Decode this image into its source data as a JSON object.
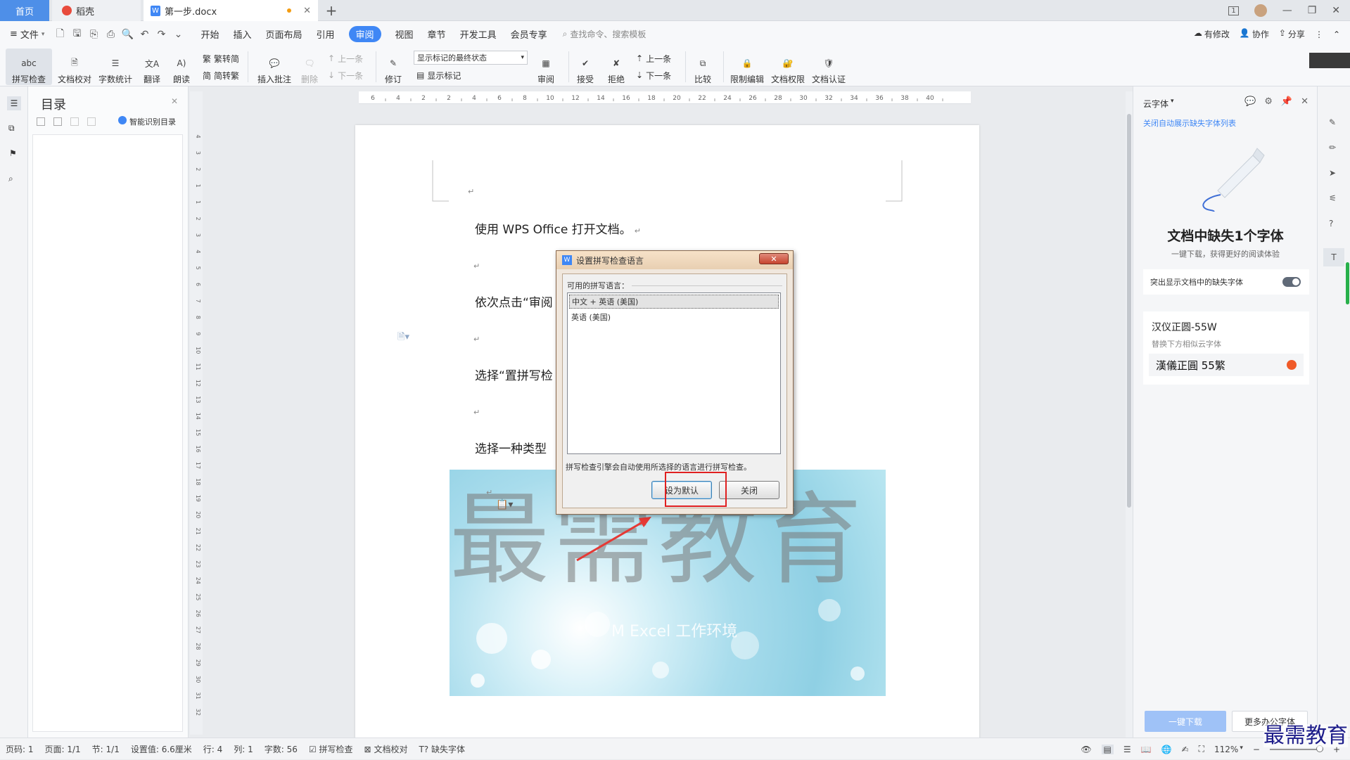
{
  "tabs": {
    "home": "首页",
    "draft": "稻壳",
    "doc": "第一步.docx",
    "add": "+"
  },
  "window": {
    "page_badge": "1"
  },
  "menu": {
    "file": "文件",
    "items": [
      "开始",
      "插入",
      "页面布局",
      "引用",
      "审阅",
      "视图",
      "章节",
      "开发工具",
      "会员专享"
    ],
    "active": "审阅",
    "search_placeholder": "查找命令、搜索模板",
    "right": {
      "changes": "有修改",
      "collab": "协作",
      "share": "分享"
    }
  },
  "ribbon": {
    "spell": "拼写检查",
    "spell_icon_text": "abc",
    "proof": "文档校对",
    "wordcount": "字数统计",
    "translate": "翻译",
    "read": "朗读",
    "trad_simp": "繁转简",
    "simp_trad": "简转繁",
    "insert_comment": "插入批注",
    "delete": "删除",
    "prev": "上一条",
    "next": "下一条",
    "track": "修订",
    "markup_state": "显示标记的最终状态",
    "show_markup": "显示标记",
    "review": "审阅",
    "accept": "接受",
    "reject": "拒绝",
    "prev2": "上一条",
    "next2": "下一条",
    "compare": "比较",
    "restrict": "限制编辑",
    "permission": "文档权限",
    "certify": "文档认证"
  },
  "toc": {
    "title": "目录",
    "smart": "智能识别目录"
  },
  "ruler": {
    "h_ticks": [
      "6",
      "4",
      "2",
      "2",
      "4",
      "6",
      "8",
      "10",
      "12",
      "14",
      "16",
      "18",
      "20",
      "22",
      "24",
      "26",
      "28",
      "30",
      "32",
      "34",
      "36",
      "38",
      "40"
    ],
    "v_ticks": [
      "4",
      "3",
      "2",
      "1",
      "1",
      "2",
      "3",
      "4",
      "5",
      "6",
      "7",
      "8",
      "9",
      "10",
      "11",
      "12",
      "13",
      "14",
      "15",
      "16",
      "17",
      "18",
      "19",
      "20",
      "21",
      "22",
      "23",
      "24",
      "25",
      "26",
      "27",
      "28",
      "29",
      "30",
      "31",
      "32"
    ]
  },
  "document": {
    "p1": "使用 WPS Office 打开文档。",
    "p2": "依次点击“审阅",
    "p3": "选择“置拼写检",
    "p4": "选择一种类型",
    "return_mark": "↵",
    "watermark": "最需教育",
    "image_caption": "M Excel 工作环境"
  },
  "dialog": {
    "title": "设置拼写检查语言",
    "group_label": "可用的拼写语言：",
    "languages": [
      "中文 + 英语 (美国)",
      "英语 (美国)"
    ],
    "selected_index": 0,
    "note": "拼写检查引擎会自动使用所选择的语言进行拼写检查。",
    "set_default": "设为默认",
    "close": "关闭"
  },
  "right_panel": {
    "header": "云字体",
    "link": "关闭自动展示缺失字体列表",
    "heading": "文档中缺失1个字体",
    "subtitle": "一键下载，获得更好的阅读体验",
    "toggle_label": "突出显示文档中的缺失字体",
    "toggle_on": false,
    "font_name": "汉仪正圆-55W",
    "replace_hint": "替换下方相似云字体",
    "font_sample": "漢儀正圓 55繁",
    "download_btn": "一键下载",
    "more_btn": "更多办公字体"
  },
  "status": {
    "page_code": "页码: 1",
    "pages": "页面: 1/1",
    "section": "节: 1/1",
    "setting": "设置值: 6.6厘米",
    "row": "行: 4",
    "col": "列: 1",
    "words": "字数: 56",
    "spell": "拼写检查",
    "proof": "文档校对",
    "missing_font": "缺失字体",
    "zoom": "112%"
  },
  "brand_stamp": "最需教育",
  "colors": {
    "accent": "#3f87f5",
    "highlight_box": "#e02020",
    "arrow": "#e53935",
    "watermark_text": "#8f8f8f"
  }
}
